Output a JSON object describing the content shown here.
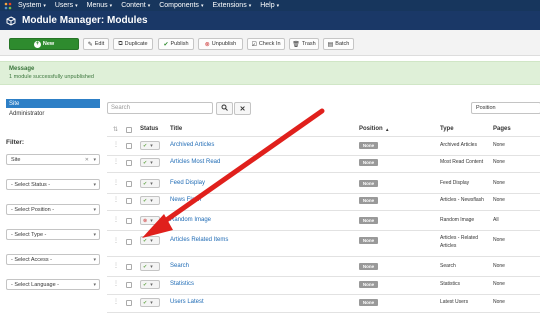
{
  "nav": {
    "items": [
      {
        "label": "System",
        "icon": "caret-down-icon"
      },
      {
        "label": "Users",
        "icon": "caret-down-icon"
      },
      {
        "label": "Menus",
        "icon": "caret-down-icon"
      },
      {
        "label": "Content",
        "icon": "caret-down-icon"
      },
      {
        "label": "Components",
        "icon": "caret-down-icon"
      },
      {
        "label": "Extensions",
        "icon": "caret-down-icon"
      },
      {
        "label": "Help",
        "icon": "caret-down-icon"
      }
    ]
  },
  "header": {
    "title": "Module Manager: Modules",
    "icon": "cube-icon"
  },
  "toolbar": {
    "new": "New",
    "edit": "Edit",
    "duplicate": "Duplicate",
    "publish": "Publish",
    "unpublish": "Unpublish",
    "checkin": "Check In",
    "trash": "Trash",
    "batch": "Batch"
  },
  "message": {
    "title": "Message",
    "body": "1 module successfully unpublished"
  },
  "sidebar": {
    "site": "Site",
    "administrator": "Administrator",
    "filter_title": "Filter:",
    "site_select": "Site",
    "filters": [
      "- Select Status -",
      "- Select Position -",
      "- Select Type -",
      "- Select Access -",
      "- Select Language -"
    ]
  },
  "search": {
    "placeholder": "Search",
    "sort": "Position"
  },
  "table": {
    "headers": {
      "status": "Status",
      "title": "Title",
      "position": "Position",
      "position_sort": "▲",
      "type": "Type",
      "pages": "Pages"
    },
    "rows": [
      {
        "title": "Archived Articles",
        "position": "None",
        "type": "Archived Articles",
        "type2": "",
        "pages": "None",
        "status": "published"
      },
      {
        "title": "Articles Most Read",
        "position": "None",
        "type": "Most Read Content",
        "type2": "",
        "pages": "None",
        "status": "published"
      },
      {
        "title": "Feed Display",
        "position": "None",
        "type": "Feed Display",
        "type2": "",
        "pages": "None",
        "status": "published"
      },
      {
        "title": "News Flash",
        "position": "None",
        "type": "Articles - Newsflash",
        "type2": "",
        "pages": "None",
        "status": "published"
      },
      {
        "title": "Random Image",
        "position": "None",
        "type": "Random Image",
        "type2": "",
        "pages": "All",
        "status": "unpublished"
      },
      {
        "title": "Articles Related Items",
        "position": "None",
        "type": "Articles - Related",
        "type2": "Articles",
        "pages": "None",
        "status": "published"
      },
      {
        "title": "Search",
        "position": "None",
        "type": "Search",
        "type2": "",
        "pages": "None",
        "status": "published"
      },
      {
        "title": "Statistics",
        "position": "None",
        "type": "Statistics",
        "type2": "",
        "pages": "None",
        "status": "published"
      },
      {
        "title": "Users Latest",
        "position": "None",
        "type": "Latest Users",
        "type2": "",
        "pages": "None",
        "status": "published"
      }
    ]
  },
  "colors": {
    "navbar": "#17365d",
    "header": "#1a3867",
    "new_button": "#2e8b2e",
    "message_bg": "#dff0d8",
    "active_side": "#2d7fc6",
    "link": "#1f6bb5",
    "arrow": "#e0201c"
  }
}
